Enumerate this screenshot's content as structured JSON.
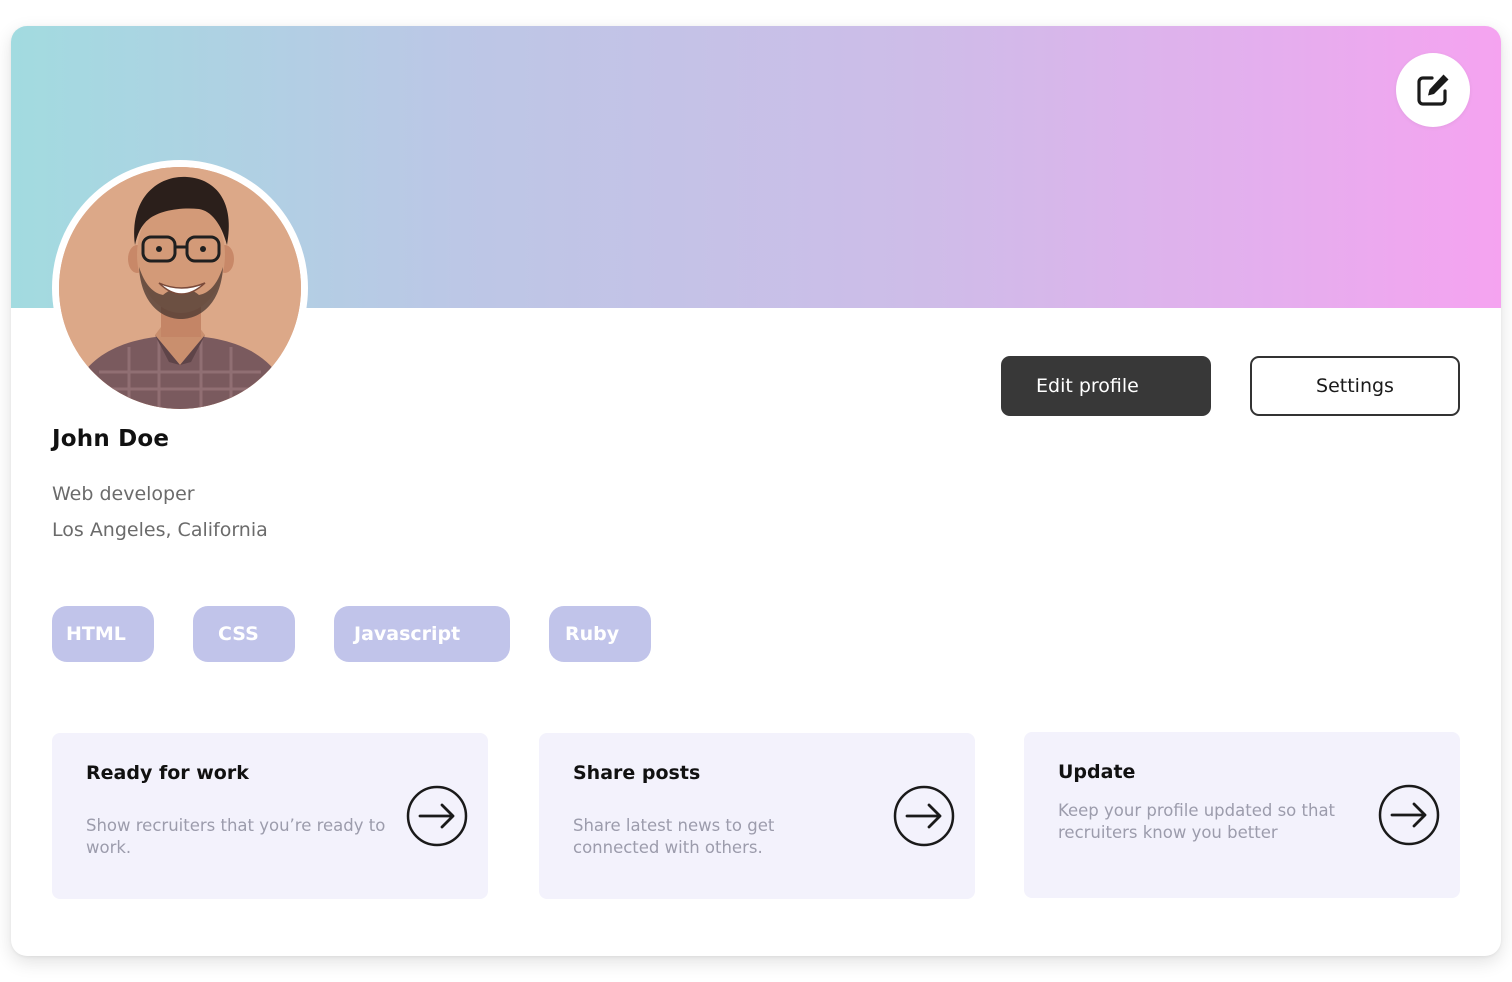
{
  "banner": {
    "edit_icon": "pencil-square-icon"
  },
  "profile": {
    "avatar_icon": "user-photo",
    "name": "John Doe",
    "role": "Web developer",
    "location": "Los Angeles, California"
  },
  "actions": {
    "edit_profile": "Edit profile",
    "settings": "Settings"
  },
  "skills": [
    "HTML",
    "CSS",
    "Javascript",
    "Ruby"
  ],
  "features": [
    {
      "title": "Ready for work",
      "description": "Show recruiters that you’re ready to work.",
      "icon": "arrow-right-circle-icon"
    },
    {
      "title": "Share posts",
      "description": "Share latest news to get connected with others.",
      "icon": "arrow-right-circle-icon"
    },
    {
      "title": "Update",
      "description": "Keep your profile updated so that recruiters know you better",
      "icon": "arrow-right-circle-icon"
    }
  ],
  "colors": {
    "banner_start": "#a2dbe0",
    "banner_end": "#f5a3f0",
    "primary_button": "#383838",
    "tag_background": "#c1c4ea",
    "card_background": "#f3f2fc"
  }
}
